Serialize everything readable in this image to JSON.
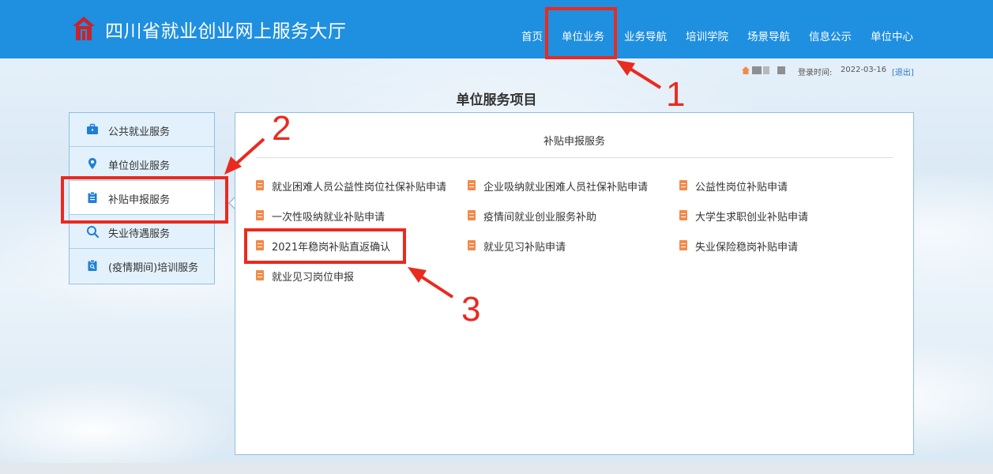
{
  "header": {
    "site_title": "四川省就业创业网上服务大厅",
    "nav": [
      {
        "label": "首页"
      },
      {
        "label": "单位业务"
      },
      {
        "label": "业务导航"
      },
      {
        "label": "培训学院"
      },
      {
        "label": "场景导航"
      },
      {
        "label": "信息公示"
      },
      {
        "label": "单位中心"
      }
    ]
  },
  "login": {
    "label": "登录时间:",
    "date": "2022-03-16",
    "logout": "[退出]"
  },
  "section_title": "单位服务项目",
  "menu": [
    {
      "label": "公共就业服务",
      "icon": "briefcase-icon"
    },
    {
      "label": "单位创业服务",
      "icon": "location-pin-icon"
    },
    {
      "label": "补贴申报服务",
      "icon": "clipboard-icon"
    },
    {
      "label": "失业待遇服务",
      "icon": "search-icon"
    },
    {
      "label": "(疫情期间)培训服务",
      "icon": "clipboard-search-icon"
    }
  ],
  "panel": {
    "title": "补贴申报服务",
    "services": [
      {
        "label": "就业困难人员公益性岗位社保补贴申请"
      },
      {
        "label": "企业吸纳就业困难人员社保补贴申请"
      },
      {
        "label": "公益性岗位补贴申请"
      },
      {
        "label": "一次性吸纳就业补贴申请"
      },
      {
        "label": "疫情间就业创业服务补助"
      },
      {
        "label": "大学生求职创业补贴申请"
      },
      {
        "label": "2021年稳岗补贴直返确认"
      },
      {
        "label": "就业见习补贴申请"
      },
      {
        "label": "失业保险稳岗补贴申请"
      },
      {
        "label": "就业见习岗位申报"
      }
    ]
  },
  "annotations": {
    "n1": "1",
    "n2": "2",
    "n3": "3"
  },
  "colors": {
    "header_bg": "#1f8fe0",
    "annotation_red": "#ea2a1f",
    "doc_icon": "#f08b4a",
    "menu_icon": "#1f7fd6"
  }
}
